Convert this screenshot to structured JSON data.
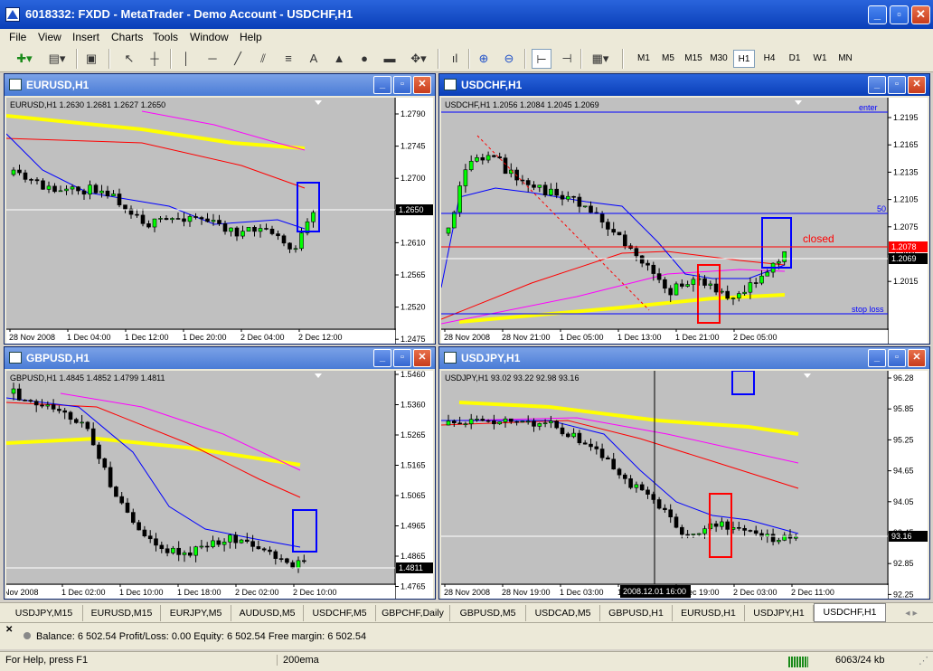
{
  "window": {
    "title": "6018332: FXDD - MetaTrader - Demo Account - USDCHF,H1"
  },
  "menu": [
    "File",
    "View",
    "Insert",
    "Charts",
    "Tools",
    "Window",
    "Help"
  ],
  "timeframes": [
    "M1",
    "M5",
    "M15",
    "M30",
    "H1",
    "H4",
    "D1",
    "W1",
    "MN"
  ],
  "active_timeframe": "H1",
  "colors": {
    "bull": "#00ff00",
    "bear": "#000000",
    "ma_fast": "#0000ff",
    "ma_mid": "#ff00ff",
    "ma_slow": "#ff0000",
    "ema200": "#ffff00",
    "box_blue": "#0000ff",
    "box_red": "#ff0000",
    "plot_bg": "#c0c0c0"
  },
  "charts": {
    "eurusd": {
      "title": "EURUSD,H1",
      "ohlc": "EURUSD,H1  1.2630 1.2681 1.2627 1.2650",
      "price_labels": [
        "1.2790",
        "1.2745",
        "1.2700",
        "1.2655",
        "1.2610",
        "1.2565",
        "1.2520",
        "1.2475"
      ],
      "current_price": "1.2650",
      "time_labels": [
        "28 Nov 2008",
        "1 Dec 04:00",
        "1 Dec 12:00",
        "1 Dec 20:00",
        "2 Dec 04:00",
        "2 Dec 12:00"
      ]
    },
    "usdchf": {
      "title": "USDCHF,H1",
      "ohlc": "USDCHF,H1  1.2056 1.2084 1.2045 1.2069",
      "price_labels": [
        "1.2195",
        "1.2165",
        "1.2135",
        "1.2105",
        "1.2075",
        "1.2045",
        "1.2015"
      ],
      "current_price": "1.2069",
      "closed_price": "1.2078",
      "annotation": "closed",
      "level_labels": [
        "enter",
        "50",
        "stop loss"
      ],
      "time_labels": [
        "28 Nov 2008",
        "28 Nov 21:00",
        "1 Dec 05:00",
        "1 Dec 13:00",
        "1 Dec 21:00",
        "2 Dec 05:00"
      ]
    },
    "gbpusd": {
      "title": "GBPUSD,H1",
      "ohlc": "GBPUSD,H1  1.4845 1.4852 1.4799 1.4811",
      "price_labels": [
        "1.5460",
        "1.5360",
        "1.5265",
        "1.5165",
        "1.5065",
        "1.4965",
        "1.4865",
        "1.4765"
      ],
      "current_price": "1.4811",
      "time_labels": [
        "Nov 2008",
        "1 Dec 02:00",
        "1 Dec 10:00",
        "1 Dec 18:00",
        "2 Dec 02:00",
        "2 Dec 10:00"
      ]
    },
    "usdjpy": {
      "title": "USDJPY,H1",
      "ohlc": "USDJPY,H1  93.02 93.22 92.98 93.16",
      "price_labels": [
        "96.28",
        "95.85",
        "95.25",
        "94.65",
        "94.05",
        "93.45",
        "92.85",
        "92.25"
      ],
      "current_price": "93.16",
      "cursor_time": "2008.12.01 16:00",
      "time_labels": [
        "28 Nov 2008",
        "28 Nov 19:00",
        "1 Dec 03:00",
        "1 Dec 11:00",
        "1 Dec 19:00",
        "2 Dec 03:00",
        "2 Dec 11:00"
      ]
    }
  },
  "tabs": [
    "USDJPY,M15",
    "EURUSD,M15",
    "EURJPY,M5",
    "AUDUSD,M5",
    "USDCHF,M5",
    "GBPCHF,Daily",
    "GBPUSD,M5",
    "USDCAD,M5",
    "GBPUSD,H1",
    "EURUSD,H1",
    "USDJPY,H1",
    "USDCHF,H1"
  ],
  "active_tab": "USDCHF,H1",
  "terminal": {
    "balance_text": "Balance: 6 502.54  Profit/Loss: 0.00  Equity: 6 502.54  Free margin: 6 502.54"
  },
  "status": {
    "help": "For Help, press F1",
    "template": "200ema",
    "traffic": "6063/24 kb"
  }
}
